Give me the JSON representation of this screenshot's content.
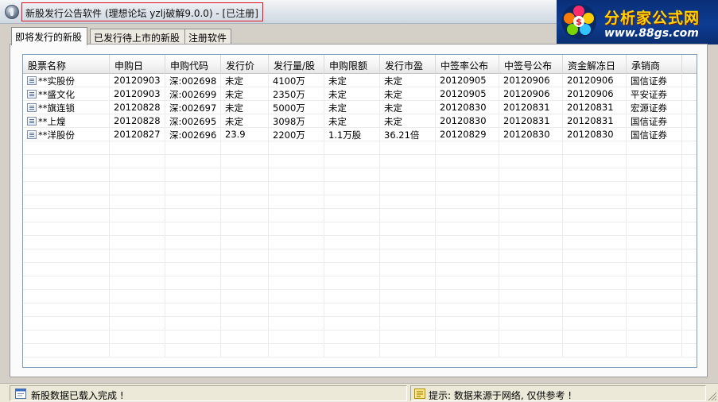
{
  "window": {
    "title": "新股发行公告软件 (理想论坛  yzlj破解9.0.0) - [已注册]"
  },
  "logo": {
    "main_text": "分析家公式网",
    "url_text": "www.88gs.com"
  },
  "tabs": [
    {
      "label": "即将发行的新股",
      "active": true
    },
    {
      "label": "已发行待上市的新股",
      "active": false
    },
    {
      "label": "注册软件",
      "active": false
    }
  ],
  "table": {
    "columns": [
      "股票名称",
      "申购日",
      "申购代码",
      "发行价",
      "发行量/股",
      "申购限额",
      "发行市盈",
      "中签率公布",
      "中签号公布",
      "资金解冻日",
      "承销商"
    ],
    "rows": [
      [
        "**实股份",
        "20120903",
        "深:002698",
        "未定",
        "4100万",
        "未定",
        "未定",
        "20120905",
        "20120906",
        "20120906",
        "国信证券"
      ],
      [
        "**盛文化",
        "20120903",
        "深:002699",
        "未定",
        "2350万",
        "未定",
        "未定",
        "20120905",
        "20120906",
        "20120906",
        "平安证券"
      ],
      [
        "**旗连锁",
        "20120828",
        "深:002697",
        "未定",
        "5000万",
        "未定",
        "未定",
        "20120830",
        "20120831",
        "20120831",
        "宏源证券"
      ],
      [
        "**上煌",
        "20120828",
        "深:002695",
        "未定",
        "3098万",
        "未定",
        "未定",
        "20120830",
        "20120831",
        "20120831",
        "国信证券"
      ],
      [
        "**洋股份",
        "20120827",
        "深:002696",
        "23.9",
        "2200万",
        "1.1万股",
        "36.21倍",
        "20120829",
        "20120830",
        "20120830",
        "国信证券"
      ]
    ]
  },
  "statusbar": {
    "left_text": "新股数据已载入完成 !",
    "right_text": "提示: 数据来源于网络, 仅供参考 !"
  },
  "colors": {
    "title_highlight_border": "#e0101a",
    "logo_background": "#0d3c92",
    "logo_text": "#ffd400"
  }
}
